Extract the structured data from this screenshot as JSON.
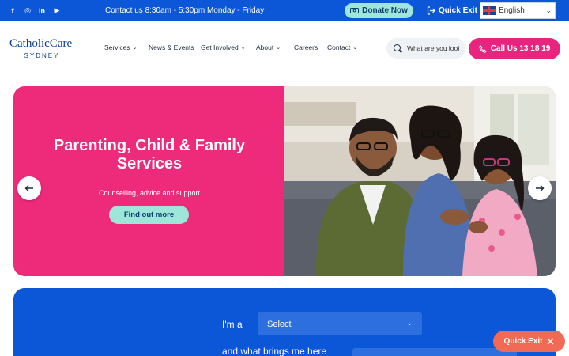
{
  "topbar": {
    "social": [
      {
        "icon": "facebook-icon",
        "glyph": "f"
      },
      {
        "icon": "instagram-icon",
        "glyph": "◎"
      },
      {
        "icon": "linkedin-icon",
        "glyph": "in"
      },
      {
        "icon": "youtube-icon",
        "glyph": "▶"
      }
    ],
    "contact_text": "Contact us 8:30am - 5:30pm Monday - Friday",
    "donate_label": "Donate Now",
    "quick_exit_label": "Quick Exit",
    "language": "English"
  },
  "header": {
    "logo_main": "CatholicCare",
    "logo_sub": "SYDNEY",
    "nav": [
      {
        "label": "Services",
        "has_dropdown": true
      },
      {
        "label": "News & Events",
        "has_dropdown": false
      },
      {
        "label": "Get Involved",
        "has_dropdown": true
      },
      {
        "label": "About",
        "has_dropdown": true
      },
      {
        "label": "Careers",
        "has_dropdown": false
      },
      {
        "label": "Contact",
        "has_dropdown": true
      }
    ],
    "search_placeholder": "What are you looking for?",
    "call_label": "Call Us 13 18 19"
  },
  "hero": {
    "title": "Parenting, Child & Family Services",
    "subtitle": "Counselling, advice and support",
    "cta_label": "Find out more",
    "image_icon": "family-photo"
  },
  "finder": {
    "label_1": "I'm a",
    "select_1_value": "Select",
    "label_2": "and what brings me here"
  },
  "quick_exit_float_label": "Quick Exit",
  "colors": {
    "brand_blue": "#0c56d8",
    "hero_pink": "#ee2a7b",
    "call_pink": "#e8247f",
    "mint": "#9ee6d9",
    "quick_exit_coral": "#f06a55"
  }
}
